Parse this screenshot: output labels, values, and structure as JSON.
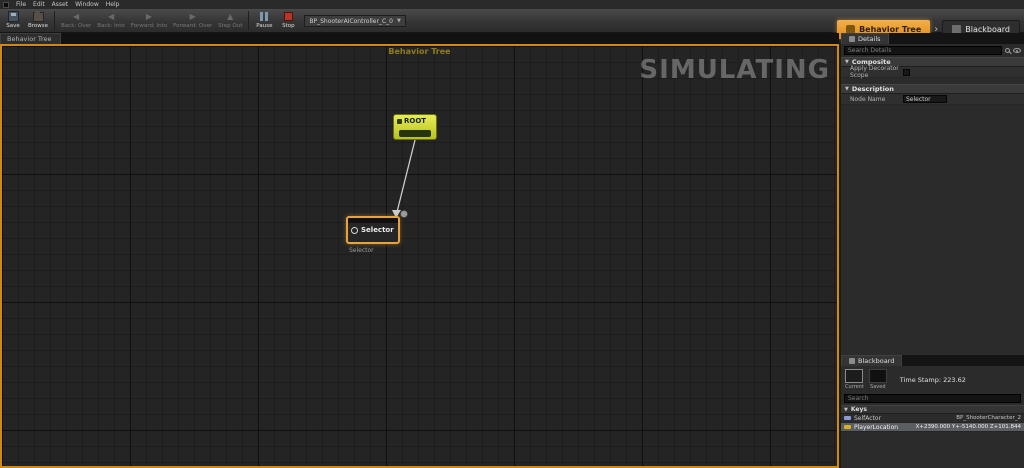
{
  "menubar": {
    "items": [
      {
        "label": "File"
      },
      {
        "label": "Edit"
      },
      {
        "label": "Asset"
      },
      {
        "label": "Window"
      },
      {
        "label": "Help"
      }
    ]
  },
  "toolbar": {
    "save_label": "Save",
    "browse_label": "Browse",
    "debug_nav": [
      {
        "label": "Back: Over"
      },
      {
        "label": "Back: Into"
      },
      {
        "label": "Forward: Into"
      },
      {
        "label": "Forward: Over"
      },
      {
        "label": "Step Out"
      }
    ],
    "pause_label": "Pause",
    "stop_label": "Stop",
    "debug_target": "BP_ShooterAIController_C_0",
    "behavior_tree_label": "Behavior Tree",
    "blackboard_label": "Blackboard"
  },
  "graph": {
    "tab_label": "Behavior Tree",
    "title": "Behavior Tree",
    "watermark": "SIMULATING",
    "nodes": {
      "root": {
        "title": "ROOT"
      },
      "selector": {
        "title": "Selector",
        "caption": "Selector"
      }
    }
  },
  "details": {
    "tab_label": "Details",
    "search_placeholder": "Search Details",
    "composite_section": "Composite",
    "apply_decorator_scope_label": "Apply Decorator Scope",
    "description_section": "Description",
    "node_name_label": "Node Name",
    "node_name_value": "Selector"
  },
  "blackboard": {
    "tab_label": "Blackboard",
    "views": [
      {
        "label": "Current"
      },
      {
        "label": "Saved"
      }
    ],
    "timestamp": "Time Stamp: 223.62",
    "search_placeholder": "Search",
    "keys_header": "Keys",
    "keys": [
      {
        "name": "SelfActor",
        "value": "BP_ShooterCharacter_2"
      },
      {
        "name": "PlayerLocation",
        "value": "X+2390.000 Y+-5140.000 Z+101.844"
      }
    ]
  },
  "colors": {
    "active_mode_orange": "#e8951e",
    "simulating_border": "#cf8a12",
    "root_node_yellow": "#c9d22c",
    "selected_node_border": "#e8a33d",
    "stop_red": "#b5352a"
  }
}
